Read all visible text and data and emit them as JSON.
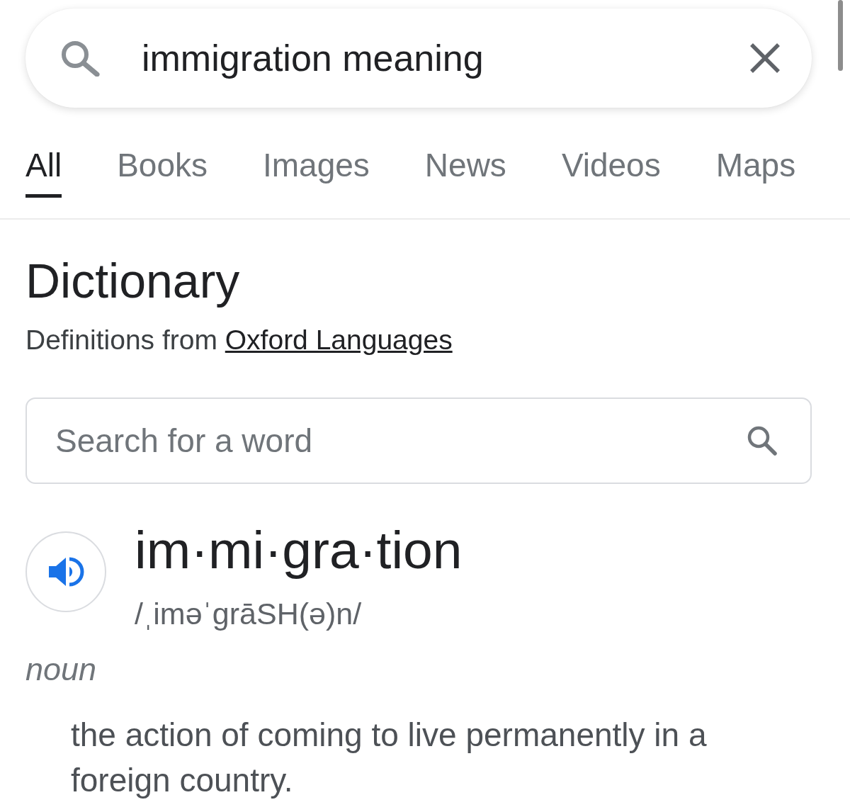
{
  "search_bar": {
    "value": "immigration meaning"
  },
  "tabs": [
    {
      "label": "All",
      "selected": true
    },
    {
      "label": "Books",
      "selected": false
    },
    {
      "label": "Images",
      "selected": false
    },
    {
      "label": "News",
      "selected": false
    },
    {
      "label": "Videos",
      "selected": false
    },
    {
      "label": "Maps",
      "selected": false
    }
  ],
  "dictionary": {
    "title": "Dictionary",
    "source_prefix": "Definitions from",
    "source_link": "Oxford Languages",
    "word_search": {
      "placeholder": "Search for a word"
    },
    "headword": "im·mi·gra·tion",
    "pronunciation": "/ˌiməˈgrāSH(ə)n/",
    "part_of_speech": "noun",
    "definitions": [
      "the action of coming to live permanently in a foreign country."
    ]
  }
}
